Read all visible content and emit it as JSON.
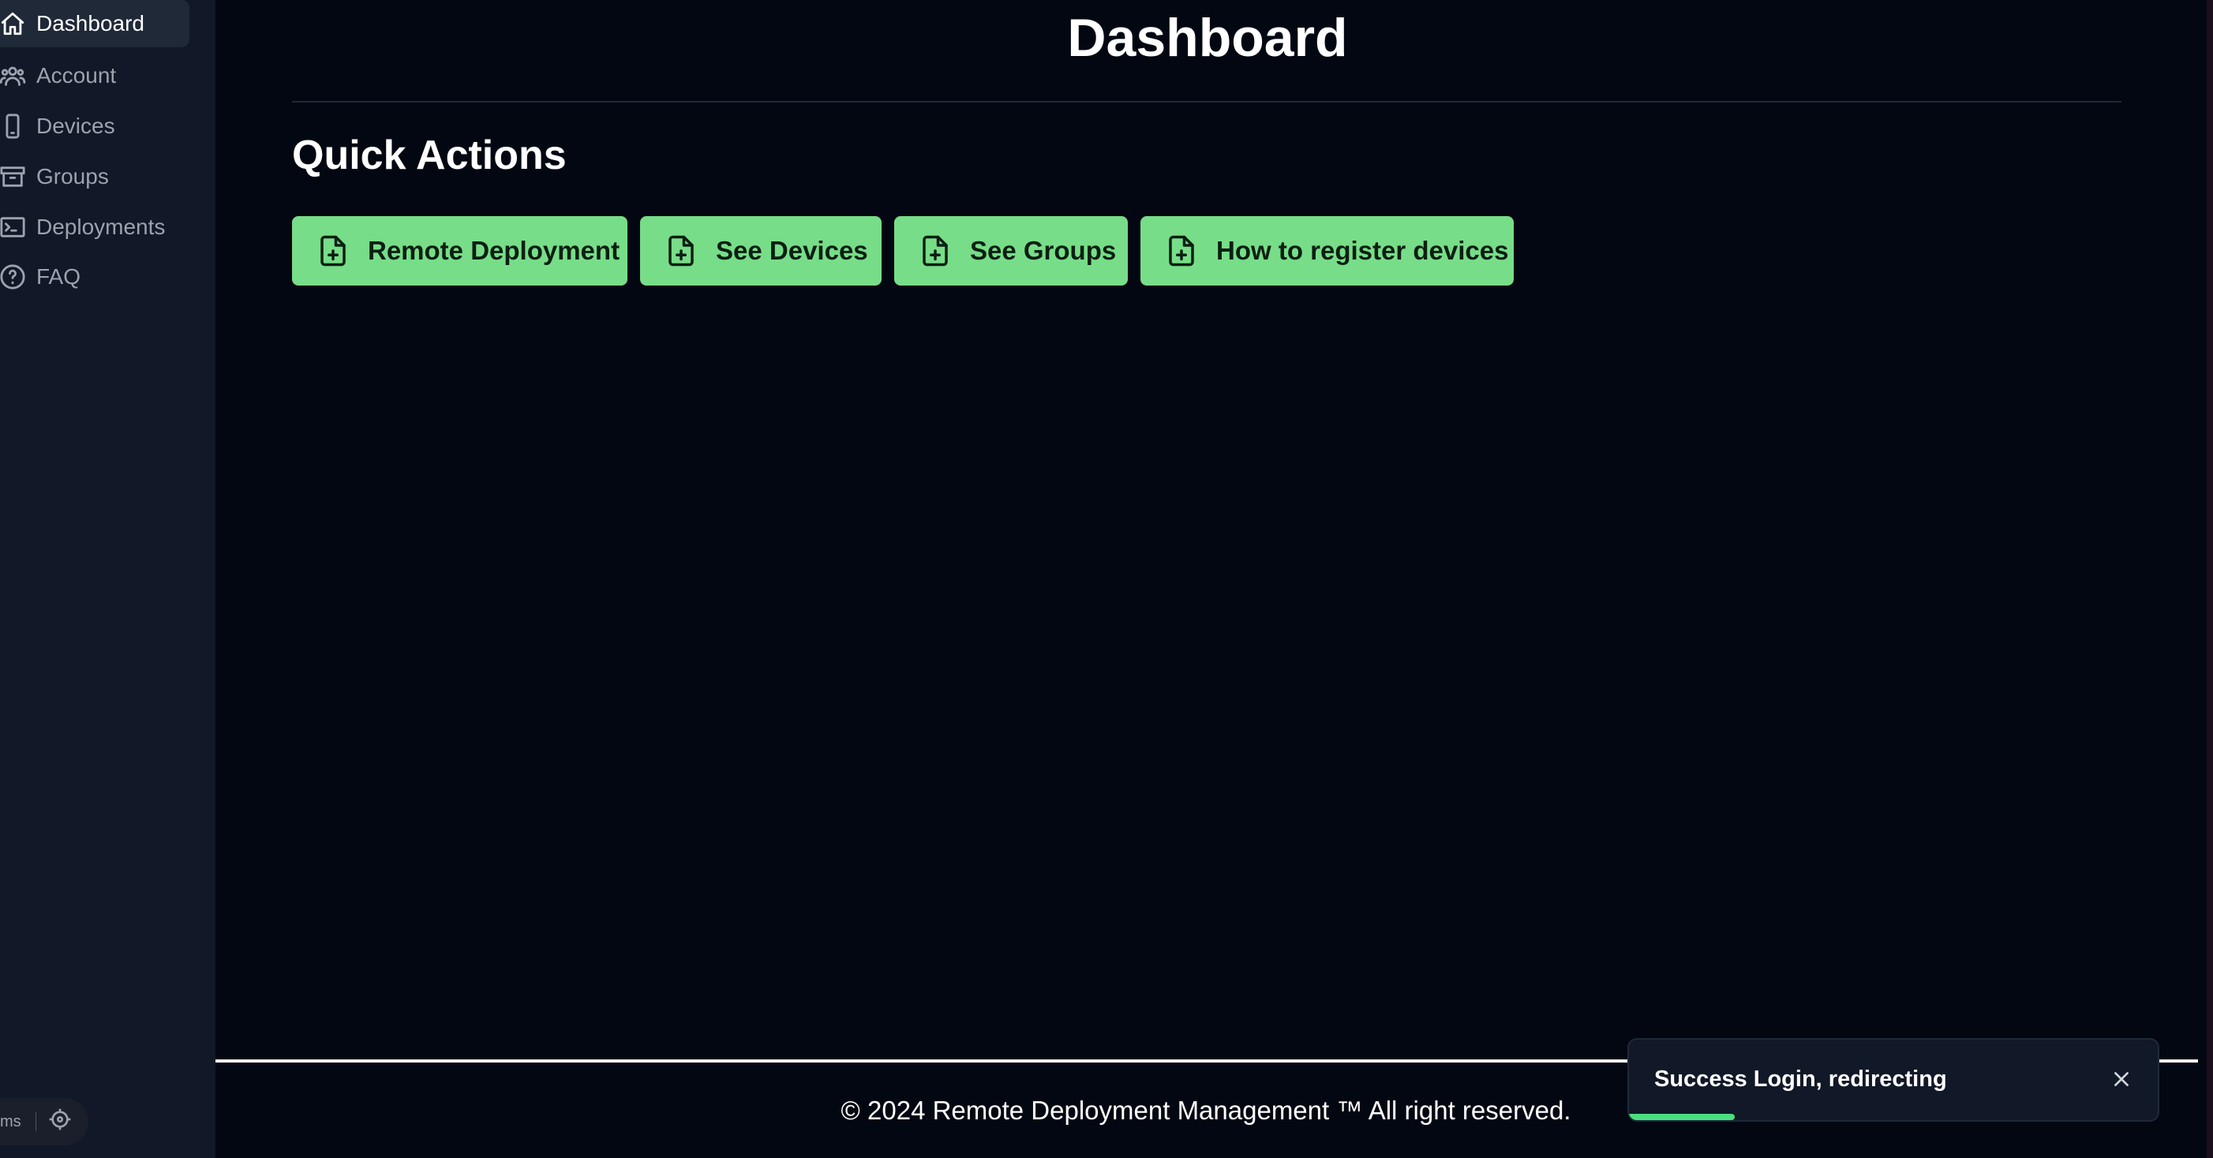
{
  "sidebar": {
    "items": [
      {
        "label": "Dashboard",
        "icon": "home-icon",
        "active": true
      },
      {
        "label": "Account",
        "icon": "users-icon",
        "active": false
      },
      {
        "label": "Devices",
        "icon": "smartphone-icon",
        "active": false
      },
      {
        "label": "Groups",
        "icon": "archive-box-icon",
        "active": false
      },
      {
        "label": "Deployments",
        "icon": "terminal-icon",
        "active": false
      },
      {
        "label": "FAQ",
        "icon": "help-circle-icon",
        "active": false
      }
    ],
    "mini_bar": {
      "label": "ms",
      "icon": "crosshair-icon"
    }
  },
  "header": {
    "title": "Dashboard"
  },
  "quick_actions": {
    "title": "Quick Actions",
    "buttons": [
      {
        "label": "Remote Deployment",
        "icon": "file-plus-icon"
      },
      {
        "label": "See Devices",
        "icon": "file-plus-icon"
      },
      {
        "label": "See Groups",
        "icon": "file-plus-icon"
      },
      {
        "label": "How to register devices",
        "icon": "file-plus-icon"
      }
    ]
  },
  "footer": {
    "text": "© 2024 Remote Deployment Management ™ All right reserved."
  },
  "toast": {
    "message": "Success Login, redirecting",
    "close_icon": "close-icon",
    "progress": 0.2
  },
  "colors": {
    "background": "#030712",
    "sidebar": "#111827",
    "button": "#77dd88",
    "toast_progress": "#4ade80"
  }
}
